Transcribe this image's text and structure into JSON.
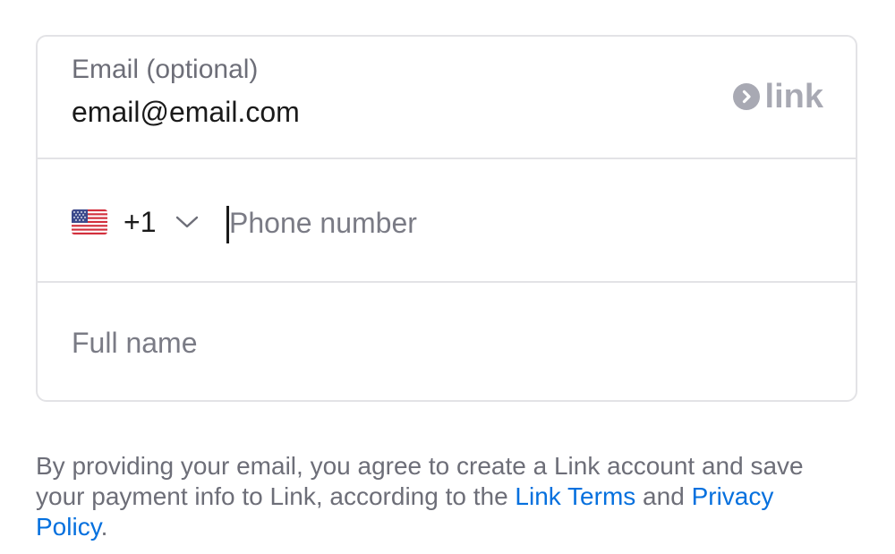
{
  "email": {
    "label": "Email (optional)",
    "value": "email@email.com"
  },
  "link_logo": {
    "icon": "chevron-right-icon",
    "text": "link",
    "color": "#a8a9b3"
  },
  "phone": {
    "country_flag": "us-flag-icon",
    "dial_code": "+1",
    "placeholder": "Phone number"
  },
  "name": {
    "placeholder": "Full name"
  },
  "consent": {
    "text_before": "By providing your email, you agree to create a Link account and save your payment info to Link, according to the ",
    "terms_link": "Link Terms",
    "text_and": " and ",
    "privacy_link": "Privacy Policy",
    "text_after": "."
  },
  "colors": {
    "link_blue": "#0570de",
    "muted_text": "#6d6e78",
    "border": "#e3e3e6"
  }
}
